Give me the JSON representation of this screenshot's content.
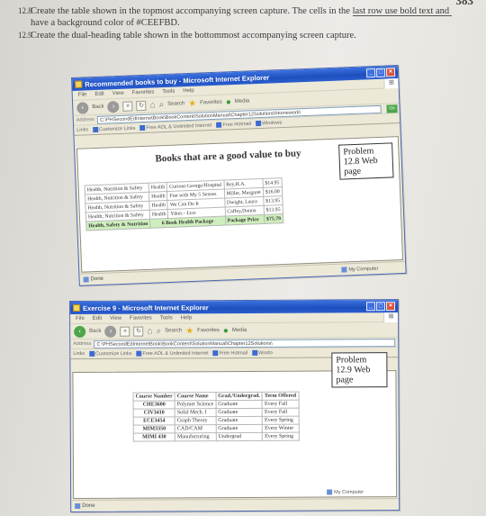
{
  "page_number": "383",
  "exercises": [
    {
      "num": "12.8",
      "text": "Create the table shown in the topmost accompanying screen capture. The cells in the last row use bold text and have a background color of #CEEFBD."
    },
    {
      "num": "12.9",
      "text": "Create the dual-heading table shown in the bottommost accompanying screen capture."
    }
  ],
  "window1": {
    "title": "Recommended books to buy - Microsoft Internet Explorer",
    "menu": [
      "File",
      "Edit",
      "View",
      "Favorites",
      "Tools",
      "Help"
    ],
    "toolbar": {
      "back": "Back",
      "search": "Search",
      "favorites": "Favorites",
      "media": "Media"
    },
    "address_label": "Address",
    "address": "C:\\PHSecondEdInternetBook\\BookContent\\SolutionManual\\Chapter12Solutions\\Homework\\",
    "go": "Go",
    "links": [
      "Links",
      "Customize Links",
      "Free AOL & Unlimited Internet",
      "Free Hotmail",
      "Windows"
    ],
    "heading": "Books that are a good value to buy",
    "problem_label": "Problem 12.8 Web page",
    "rows": [
      [
        "Health, Nutrition & Safety",
        "Health",
        "Curious George/Hospital",
        "Rey,H.A.",
        "$14.95"
      ],
      [
        "Health, Nutrition & Safety",
        "Health",
        "Fun with My 5 Senses",
        "Miller, Margaret",
        "$16.00"
      ],
      [
        "Health, Nutrition & Safety",
        "Health",
        "We Can Do It",
        "Dwight, Laura",
        "$13.95"
      ],
      [
        "Health, Nutrition & Safety",
        "Health",
        "Yikes - Lice",
        "Caffey,Donna",
        "$13.95"
      ]
    ],
    "last_row": [
      "Health, Safety & Nutrition",
      "6 Book Health Package",
      "Package Price",
      "$75.79"
    ],
    "last_row_bg": "#CEEFBD",
    "status_left": "Done",
    "status_right": "My Computer"
  },
  "window2": {
    "title": "Exercise 9 - Microsoft Internet Explorer",
    "menu": [
      "File",
      "Edit",
      "View",
      "Favorites",
      "Tools",
      "Help"
    ],
    "toolbar": {
      "back": "Back",
      "search": "Search",
      "favorites": "Favorites",
      "media": "Media"
    },
    "address_label": "Address",
    "address": "C:\\PHSecondEdInternetBook\\BookContent\\SolutionManual\\Chapter12Solutions\\",
    "links": [
      "Links",
      "Customize Links",
      "Free AOL & Unlimited Internet",
      "Free Hotmail",
      "Windo"
    ],
    "problem_label": "Problem 12.9 Web page",
    "headers": [
      "Course Number",
      "Course Name",
      "Grad./Undergrad.",
      "Term Offered"
    ],
    "rows": [
      [
        "CHE3600",
        "Polymer Science",
        "Graduate",
        "Every Fall"
      ],
      [
        "CIV3410",
        "Solid Mech. I",
        "Graduate",
        "Every Fall"
      ],
      [
        "ECE3454",
        "Graph Theory",
        "Graduate",
        "Every Spring"
      ],
      [
        "MIM3350",
        "CAD/CAM",
        "Graduate",
        "Every Winter"
      ],
      [
        "MIMI 430",
        "Manufacturing",
        "Undergrad",
        "Every Spring"
      ]
    ],
    "status_left": "Done",
    "status_right": "My Computer"
  }
}
